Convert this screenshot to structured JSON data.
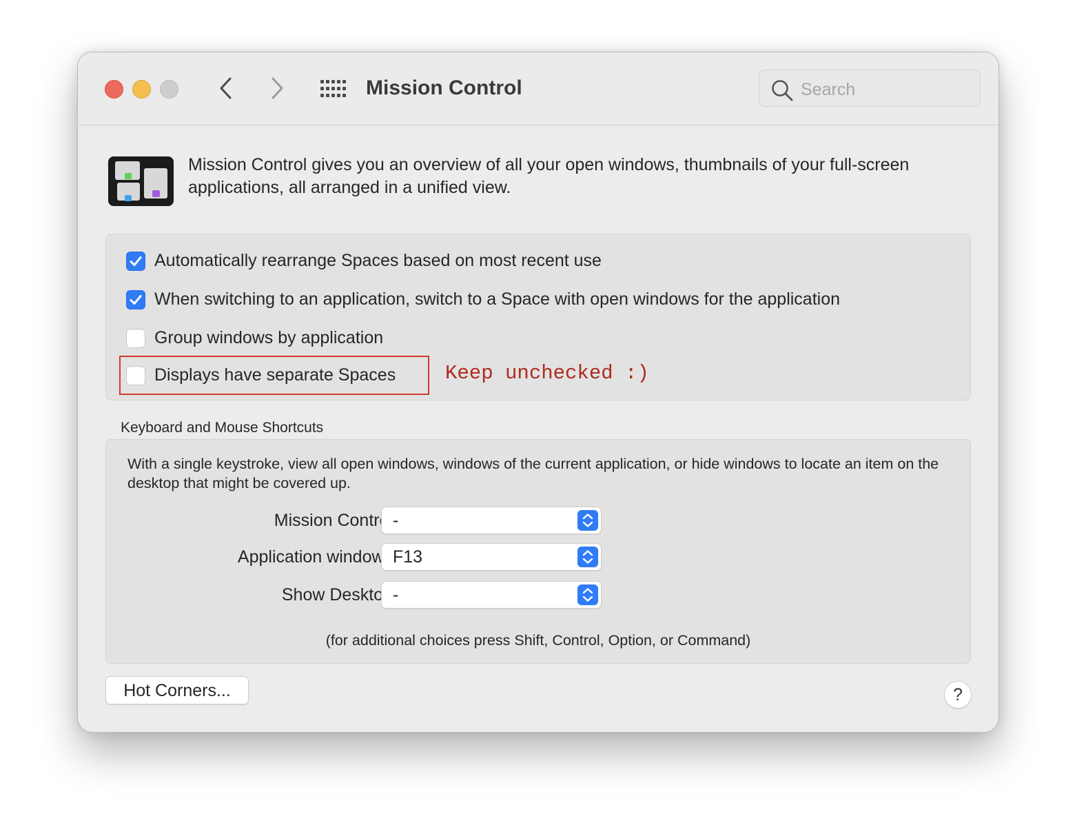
{
  "window": {
    "title": "Mission Control"
  },
  "toolbar": {
    "back_icon": "chevron-left-icon",
    "forward_icon": "chevron-right-icon",
    "grid_icon": "show-all-grid-icon"
  },
  "search": {
    "placeholder": "Search",
    "value": ""
  },
  "intro": {
    "text": "Mission Control gives you an overview of all your open windows, thumbnails of your full-screen applications, all arranged in a unified view."
  },
  "options": [
    {
      "label": "Automatically rearrange Spaces based on most recent use",
      "checked": true
    },
    {
      "label": "When switching to an application, switch to a Space with open windows for the application",
      "checked": true
    },
    {
      "label": "Group windows by application",
      "checked": false
    },
    {
      "label": "Displays have separate Spaces",
      "checked": false
    }
  ],
  "annotation": {
    "text": "Keep unchecked :)",
    "color": "#b02a1f"
  },
  "shortcuts": {
    "section_label": "Keyboard and Mouse Shortcuts",
    "description": "With a single keystroke, view all open windows, windows of the current application, or hide windows to locate an item on the desktop that might be covered up.",
    "rows": [
      {
        "label": "Mission Control:",
        "value": "-"
      },
      {
        "label": "Application windows:",
        "value": "F13"
      },
      {
        "label": "Show Desktop:",
        "value": "-"
      }
    ],
    "footnote": "(for additional choices press Shift, Control, Option, or Command)"
  },
  "buttons": {
    "hot_corners": "Hot Corners...",
    "help": "?"
  },
  "colors": {
    "accent": "#2f7cf6",
    "close": "#ed6a5e",
    "minimize": "#f5bf4f",
    "zoom_disabled": "#cdcdcd"
  }
}
